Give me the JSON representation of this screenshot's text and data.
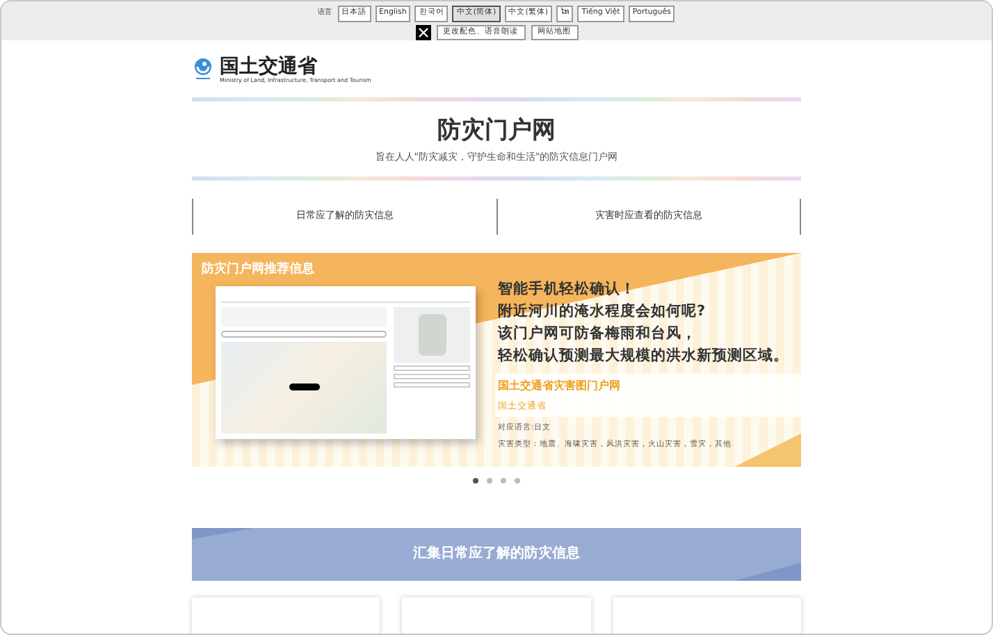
{
  "top_bar": {
    "language_label": "语言",
    "languages": [
      {
        "label": "日本語",
        "selected": false
      },
      {
        "label": "English",
        "selected": false
      },
      {
        "label": "한국어",
        "selected": false
      },
      {
        "label": "中文(简体)",
        "selected": true
      },
      {
        "label": "中文(繁体)",
        "selected": false
      },
      {
        "label": "ໄທ",
        "selected": false
      },
      {
        "label": "Tiếng Việt",
        "selected": false
      },
      {
        "label": "Português",
        "selected": false
      }
    ],
    "links": [
      "更改配色、语音朗读",
      "网站地图"
    ]
  },
  "header": {
    "logo_title": "国土交通省",
    "logo_subtitle": "Ministry of Land, Infrastructure, Transport and Tourism"
  },
  "hero": {
    "title": "防灾门户网",
    "subtitle": "旨在人人\"防灾减灾，守护生命和生活\"的防灾信息门户网"
  },
  "nav_tabs": [
    {
      "label": "日常应了解的防灾信息"
    },
    {
      "label": "灾害时应查看的防灾信息"
    }
  ],
  "carousel": {
    "badge": "防灾门户网推荐信息",
    "headline": [
      "智能手机轻松确认！",
      "附近河川的淹水程度会如何呢?",
      "该门户网可防备梅雨和台风，",
      "轻松确认预测最大规模的洪水新预测区域。"
    ],
    "site_name": "国土交通省灾害图门户网",
    "publisher": "国土交通省",
    "language": "对应语言:日文",
    "disaster_types": "灾害类型：地震、海啸灾害，风洪灾害，火山灾害，雪灾，其他",
    "dots": [
      {
        "selected": true
      },
      {
        "selected": false
      },
      {
        "selected": false
      },
      {
        "selected": false
      }
    ]
  },
  "section": {
    "title": "汇集日常应了解的防灾信息"
  }
}
